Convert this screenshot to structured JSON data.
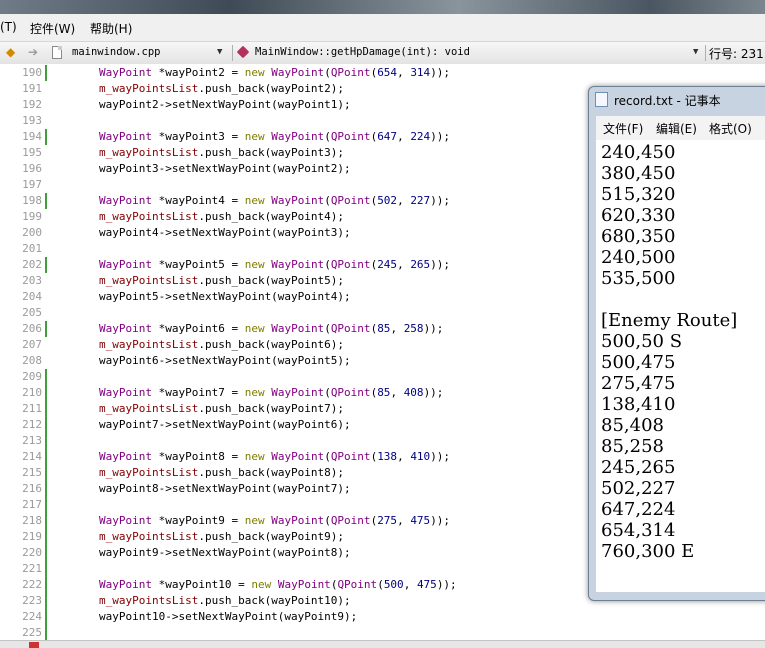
{
  "menubar": {
    "items": [
      "(T)",
      "控件(W)",
      "帮助(H)"
    ]
  },
  "editor_toolbar": {
    "file_name": "mainwindow.cpp",
    "function_signature": "MainWindow::getHpDamage(int): void",
    "line_position": "行号: 231"
  },
  "code_lines": [
    {
      "num": "190",
      "changed": true,
      "tokens": [
        {
          "t": "WayPoint",
          "c": "tp"
        },
        {
          "t": " *wayPoint2 = ",
          "c": "pl"
        },
        {
          "t": "new",
          "c": "kw"
        },
        {
          "t": " ",
          "c": "pl"
        },
        {
          "t": "WayPoint",
          "c": "tp"
        },
        {
          "t": "(",
          "c": "pl"
        },
        {
          "t": "QPoint",
          "c": "tp"
        },
        {
          "t": "(",
          "c": "pl"
        },
        {
          "t": "654",
          "c": "num"
        },
        {
          "t": ", ",
          "c": "pl"
        },
        {
          "t": "314",
          "c": "num"
        },
        {
          "t": "));",
          "c": "pl"
        }
      ]
    },
    {
      "num": "191",
      "changed": false,
      "tokens": [
        {
          "t": "m_wayPointsList",
          "c": "mem"
        },
        {
          "t": ".push_back(wayPoint2);",
          "c": "pl"
        }
      ]
    },
    {
      "num": "192",
      "changed": false,
      "tokens": [
        {
          "t": "wayPoint2->setNextWayPoint(wayPoint1);",
          "c": "pl"
        }
      ]
    },
    {
      "num": "193",
      "changed": false,
      "tokens": []
    },
    {
      "num": "194",
      "changed": true,
      "tokens": [
        {
          "t": "WayPoint",
          "c": "tp"
        },
        {
          "t": " *wayPoint3 = ",
          "c": "pl"
        },
        {
          "t": "new",
          "c": "kw"
        },
        {
          "t": " ",
          "c": "pl"
        },
        {
          "t": "WayPoint",
          "c": "tp"
        },
        {
          "t": "(",
          "c": "pl"
        },
        {
          "t": "QPoint",
          "c": "tp"
        },
        {
          "t": "(",
          "c": "pl"
        },
        {
          "t": "647",
          "c": "num"
        },
        {
          "t": ", ",
          "c": "pl"
        },
        {
          "t": "224",
          "c": "num"
        },
        {
          "t": "));",
          "c": "pl"
        }
      ]
    },
    {
      "num": "195",
      "changed": false,
      "tokens": [
        {
          "t": "m_wayPointsList",
          "c": "mem"
        },
        {
          "t": ".push_back(wayPoint3);",
          "c": "pl"
        }
      ]
    },
    {
      "num": "196",
      "changed": false,
      "tokens": [
        {
          "t": "wayPoint3->setNextWayPoint(wayPoint2);",
          "c": "pl"
        }
      ]
    },
    {
      "num": "197",
      "changed": false,
      "tokens": []
    },
    {
      "num": "198",
      "changed": true,
      "tokens": [
        {
          "t": "WayPoint",
          "c": "tp"
        },
        {
          "t": " *wayPoint4 = ",
          "c": "pl"
        },
        {
          "t": "new",
          "c": "kw"
        },
        {
          "t": " ",
          "c": "pl"
        },
        {
          "t": "WayPoint",
          "c": "tp"
        },
        {
          "t": "(",
          "c": "pl"
        },
        {
          "t": "QPoint",
          "c": "tp"
        },
        {
          "t": "(",
          "c": "pl"
        },
        {
          "t": "502",
          "c": "num"
        },
        {
          "t": ", ",
          "c": "pl"
        },
        {
          "t": "227",
          "c": "num"
        },
        {
          "t": "));",
          "c": "pl"
        }
      ]
    },
    {
      "num": "199",
      "changed": false,
      "tokens": [
        {
          "t": "m_wayPointsList",
          "c": "mem"
        },
        {
          "t": ".push_back(wayPoint4);",
          "c": "pl"
        }
      ]
    },
    {
      "num": "200",
      "changed": false,
      "tokens": [
        {
          "t": "wayPoint4->setNextWayPoint(wayPoint3);",
          "c": "pl"
        }
      ]
    },
    {
      "num": "201",
      "changed": false,
      "tokens": []
    },
    {
      "num": "202",
      "changed": true,
      "tokens": [
        {
          "t": "WayPoint",
          "c": "tp"
        },
        {
          "t": " *wayPoint5 = ",
          "c": "pl"
        },
        {
          "t": "new",
          "c": "kw"
        },
        {
          "t": " ",
          "c": "pl"
        },
        {
          "t": "WayPoint",
          "c": "tp"
        },
        {
          "t": "(",
          "c": "pl"
        },
        {
          "t": "QPoint",
          "c": "tp"
        },
        {
          "t": "(",
          "c": "pl"
        },
        {
          "t": "245",
          "c": "num"
        },
        {
          "t": ", ",
          "c": "pl"
        },
        {
          "t": "265",
          "c": "num"
        },
        {
          "t": "));",
          "c": "pl"
        }
      ]
    },
    {
      "num": "203",
      "changed": false,
      "tokens": [
        {
          "t": "m_wayPointsList",
          "c": "mem"
        },
        {
          "t": ".push_back(wayPoint5);",
          "c": "pl"
        }
      ]
    },
    {
      "num": "204",
      "changed": false,
      "tokens": [
        {
          "t": "wayPoint5->setNextWayPoint(wayPoint4);",
          "c": "pl"
        }
      ]
    },
    {
      "num": "205",
      "changed": false,
      "tokens": []
    },
    {
      "num": "206",
      "changed": true,
      "tokens": [
        {
          "t": "WayPoint",
          "c": "tp"
        },
        {
          "t": " *wayPoint6 = ",
          "c": "pl"
        },
        {
          "t": "new",
          "c": "kw"
        },
        {
          "t": " ",
          "c": "pl"
        },
        {
          "t": "WayPoint",
          "c": "tp"
        },
        {
          "t": "(",
          "c": "pl"
        },
        {
          "t": "QPoint",
          "c": "tp"
        },
        {
          "t": "(",
          "c": "pl"
        },
        {
          "t": "85",
          "c": "num"
        },
        {
          "t": ", ",
          "c": "pl"
        },
        {
          "t": "258",
          "c": "num"
        },
        {
          "t": "));",
          "c": "pl"
        }
      ]
    },
    {
      "num": "207",
      "changed": false,
      "tokens": [
        {
          "t": "m_wayPointsList",
          "c": "mem"
        },
        {
          "t": ".push_back(wayPoint6);",
          "c": "pl"
        }
      ]
    },
    {
      "num": "208",
      "changed": false,
      "tokens": [
        {
          "t": "wayPoint6->setNextWayPoint(wayPoint5);",
          "c": "pl"
        }
      ]
    },
    {
      "num": "209",
      "changed": true,
      "tokens": []
    },
    {
      "num": "210",
      "changed": true,
      "tokens": [
        {
          "t": "WayPoint",
          "c": "tp"
        },
        {
          "t": " *wayPoint7 = ",
          "c": "pl"
        },
        {
          "t": "new",
          "c": "kw"
        },
        {
          "t": " ",
          "c": "pl"
        },
        {
          "t": "WayPoint",
          "c": "tp"
        },
        {
          "t": "(",
          "c": "pl"
        },
        {
          "t": "QPoint",
          "c": "tp"
        },
        {
          "t": "(",
          "c": "pl"
        },
        {
          "t": "85",
          "c": "num"
        },
        {
          "t": ", ",
          "c": "pl"
        },
        {
          "t": "408",
          "c": "num"
        },
        {
          "t": "));",
          "c": "pl"
        }
      ]
    },
    {
      "num": "211",
      "changed": true,
      "tokens": [
        {
          "t": "m_wayPointsList",
          "c": "mem"
        },
        {
          "t": ".push_back(wayPoint7);",
          "c": "pl"
        }
      ]
    },
    {
      "num": "212",
      "changed": true,
      "tokens": [
        {
          "t": "wayPoint7->setNextWayPoint(wayPoint6);",
          "c": "pl"
        }
      ]
    },
    {
      "num": "213",
      "changed": true,
      "tokens": []
    },
    {
      "num": "214",
      "changed": true,
      "tokens": [
        {
          "t": "WayPoint",
          "c": "tp"
        },
        {
          "t": " *wayPoint8 = ",
          "c": "pl"
        },
        {
          "t": "new",
          "c": "kw"
        },
        {
          "t": " ",
          "c": "pl"
        },
        {
          "t": "WayPoint",
          "c": "tp"
        },
        {
          "t": "(",
          "c": "pl"
        },
        {
          "t": "QPoint",
          "c": "tp"
        },
        {
          "t": "(",
          "c": "pl"
        },
        {
          "t": "138",
          "c": "num"
        },
        {
          "t": ", ",
          "c": "pl"
        },
        {
          "t": "410",
          "c": "num"
        },
        {
          "t": "));",
          "c": "pl"
        }
      ]
    },
    {
      "num": "215",
      "changed": true,
      "tokens": [
        {
          "t": "m_wayPointsList",
          "c": "mem"
        },
        {
          "t": ".push_back(wayPoint8);",
          "c": "pl"
        }
      ]
    },
    {
      "num": "216",
      "changed": true,
      "tokens": [
        {
          "t": "wayPoint8->setNextWayPoint(wayPoint7);",
          "c": "pl"
        }
      ]
    },
    {
      "num": "217",
      "changed": true,
      "tokens": []
    },
    {
      "num": "218",
      "changed": true,
      "tokens": [
        {
          "t": "WayPoint",
          "c": "tp"
        },
        {
          "t": " *wayPoint9 = ",
          "c": "pl"
        },
        {
          "t": "new",
          "c": "kw"
        },
        {
          "t": " ",
          "c": "pl"
        },
        {
          "t": "WayPoint",
          "c": "tp"
        },
        {
          "t": "(",
          "c": "pl"
        },
        {
          "t": "QPoint",
          "c": "tp"
        },
        {
          "t": "(",
          "c": "pl"
        },
        {
          "t": "275",
          "c": "num"
        },
        {
          "t": ", ",
          "c": "pl"
        },
        {
          "t": "475",
          "c": "num"
        },
        {
          "t": "));",
          "c": "pl"
        }
      ]
    },
    {
      "num": "219",
      "changed": true,
      "tokens": [
        {
          "t": "m_wayPointsList",
          "c": "mem"
        },
        {
          "t": ".push_back(wayPoint9);",
          "c": "pl"
        }
      ]
    },
    {
      "num": "220",
      "changed": true,
      "tokens": [
        {
          "t": "wayPoint9->setNextWayPoint(wayPoint8);",
          "c": "pl"
        }
      ]
    },
    {
      "num": "221",
      "changed": true,
      "tokens": []
    },
    {
      "num": "222",
      "changed": true,
      "tokens": [
        {
          "t": "WayPoint",
          "c": "tp"
        },
        {
          "t": " *wayPoint10 = ",
          "c": "pl"
        },
        {
          "t": "new",
          "c": "kw"
        },
        {
          "t": " ",
          "c": "pl"
        },
        {
          "t": "WayPoint",
          "c": "tp"
        },
        {
          "t": "(",
          "c": "pl"
        },
        {
          "t": "QPoint",
          "c": "tp"
        },
        {
          "t": "(",
          "c": "pl"
        },
        {
          "t": "500",
          "c": "num"
        },
        {
          "t": ", ",
          "c": "pl"
        },
        {
          "t": "475",
          "c": "num"
        },
        {
          "t": "));",
          "c": "pl"
        }
      ]
    },
    {
      "num": "223",
      "changed": true,
      "tokens": [
        {
          "t": "m_wayPointsList",
          "c": "mem"
        },
        {
          "t": ".push_back(wayPoint10);",
          "c": "pl"
        }
      ]
    },
    {
      "num": "224",
      "changed": true,
      "tokens": [
        {
          "t": "wayPoint10->setNextWayPoint(wayPoint9);",
          "c": "pl"
        }
      ]
    },
    {
      "num": "225",
      "changed": true,
      "tokens": []
    }
  ],
  "notepad": {
    "title": "record.txt - 记事本",
    "menu": [
      "文件(F)",
      "编辑(E)",
      "格式(O)"
    ],
    "lines": [
      "240,450",
      "380,450",
      "515,320",
      "620,330",
      "680,350",
      "240,500",
      "535,500",
      "",
      "[Enemy Route]",
      "500,50 S",
      "500,475",
      "275,475",
      "138,410",
      "85,408",
      "85,258",
      "245,265",
      "502,227",
      "647,224",
      "654,314",
      "760,300 E"
    ]
  },
  "colors": {
    "keyword": "#7e7e00",
    "type": "#800080",
    "member": "#800000",
    "number": "#000080",
    "change_marker": "#3ca13c"
  }
}
